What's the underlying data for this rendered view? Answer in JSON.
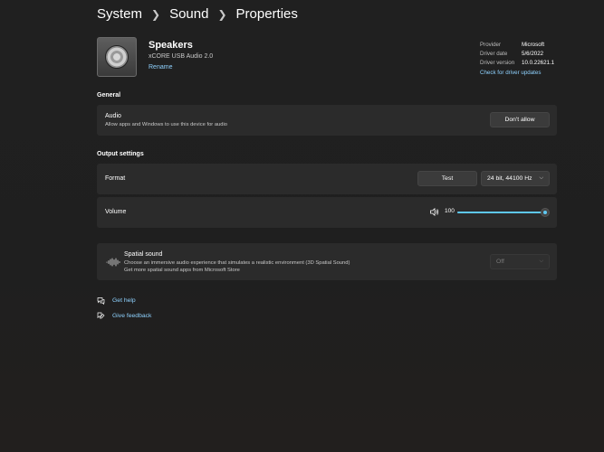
{
  "breadcrumb": {
    "level1": "System",
    "level2": "Sound",
    "level3": "Properties"
  },
  "device": {
    "name": "Speakers",
    "model": "xCORE USB Audio 2.0",
    "rename_label": "Rename"
  },
  "driver": {
    "provider_label": "Provider",
    "provider_value": "Microsoft",
    "date_label": "Driver date",
    "date_value": "5/6/2022",
    "version_label": "Driver version",
    "version_value": "10.0.22621.1",
    "update_link": "Check for driver updates"
  },
  "general": {
    "heading": "General",
    "audio_title": "Audio",
    "audio_desc": "Allow apps and Windows to use this device for audio",
    "dont_allow_label": "Don't allow"
  },
  "output": {
    "heading": "Output settings",
    "format_label": "Format",
    "test_label": "Test",
    "format_value": "24 bit, 44100 Hz",
    "volume_label": "Volume",
    "volume_value": "100",
    "volume_level": 1.0
  },
  "spatial": {
    "title": "Spatial sound",
    "desc": "Choose an immersive audio experience that simulates a realistic environment (3D Spatial Sound)",
    "store_link": "Get more spatial sound apps from Microsoft Store",
    "value": "Off",
    "disabled": true
  },
  "links": {
    "help": "Get help",
    "feedback": "Give feedback"
  },
  "colors": {
    "accent": "#5ec8f2",
    "link": "#8fd2ff",
    "card": "#2b2b2b",
    "background": "#202020"
  },
  "icons": {
    "device": "speaker-icon",
    "chevron": "chevron-right-icon",
    "dropdown": "chevron-down-icon",
    "volume": "speaker-volume-icon",
    "spatial": "spatial-audio-icon",
    "help": "help-chat-icon",
    "feedback": "feedback-icon"
  }
}
